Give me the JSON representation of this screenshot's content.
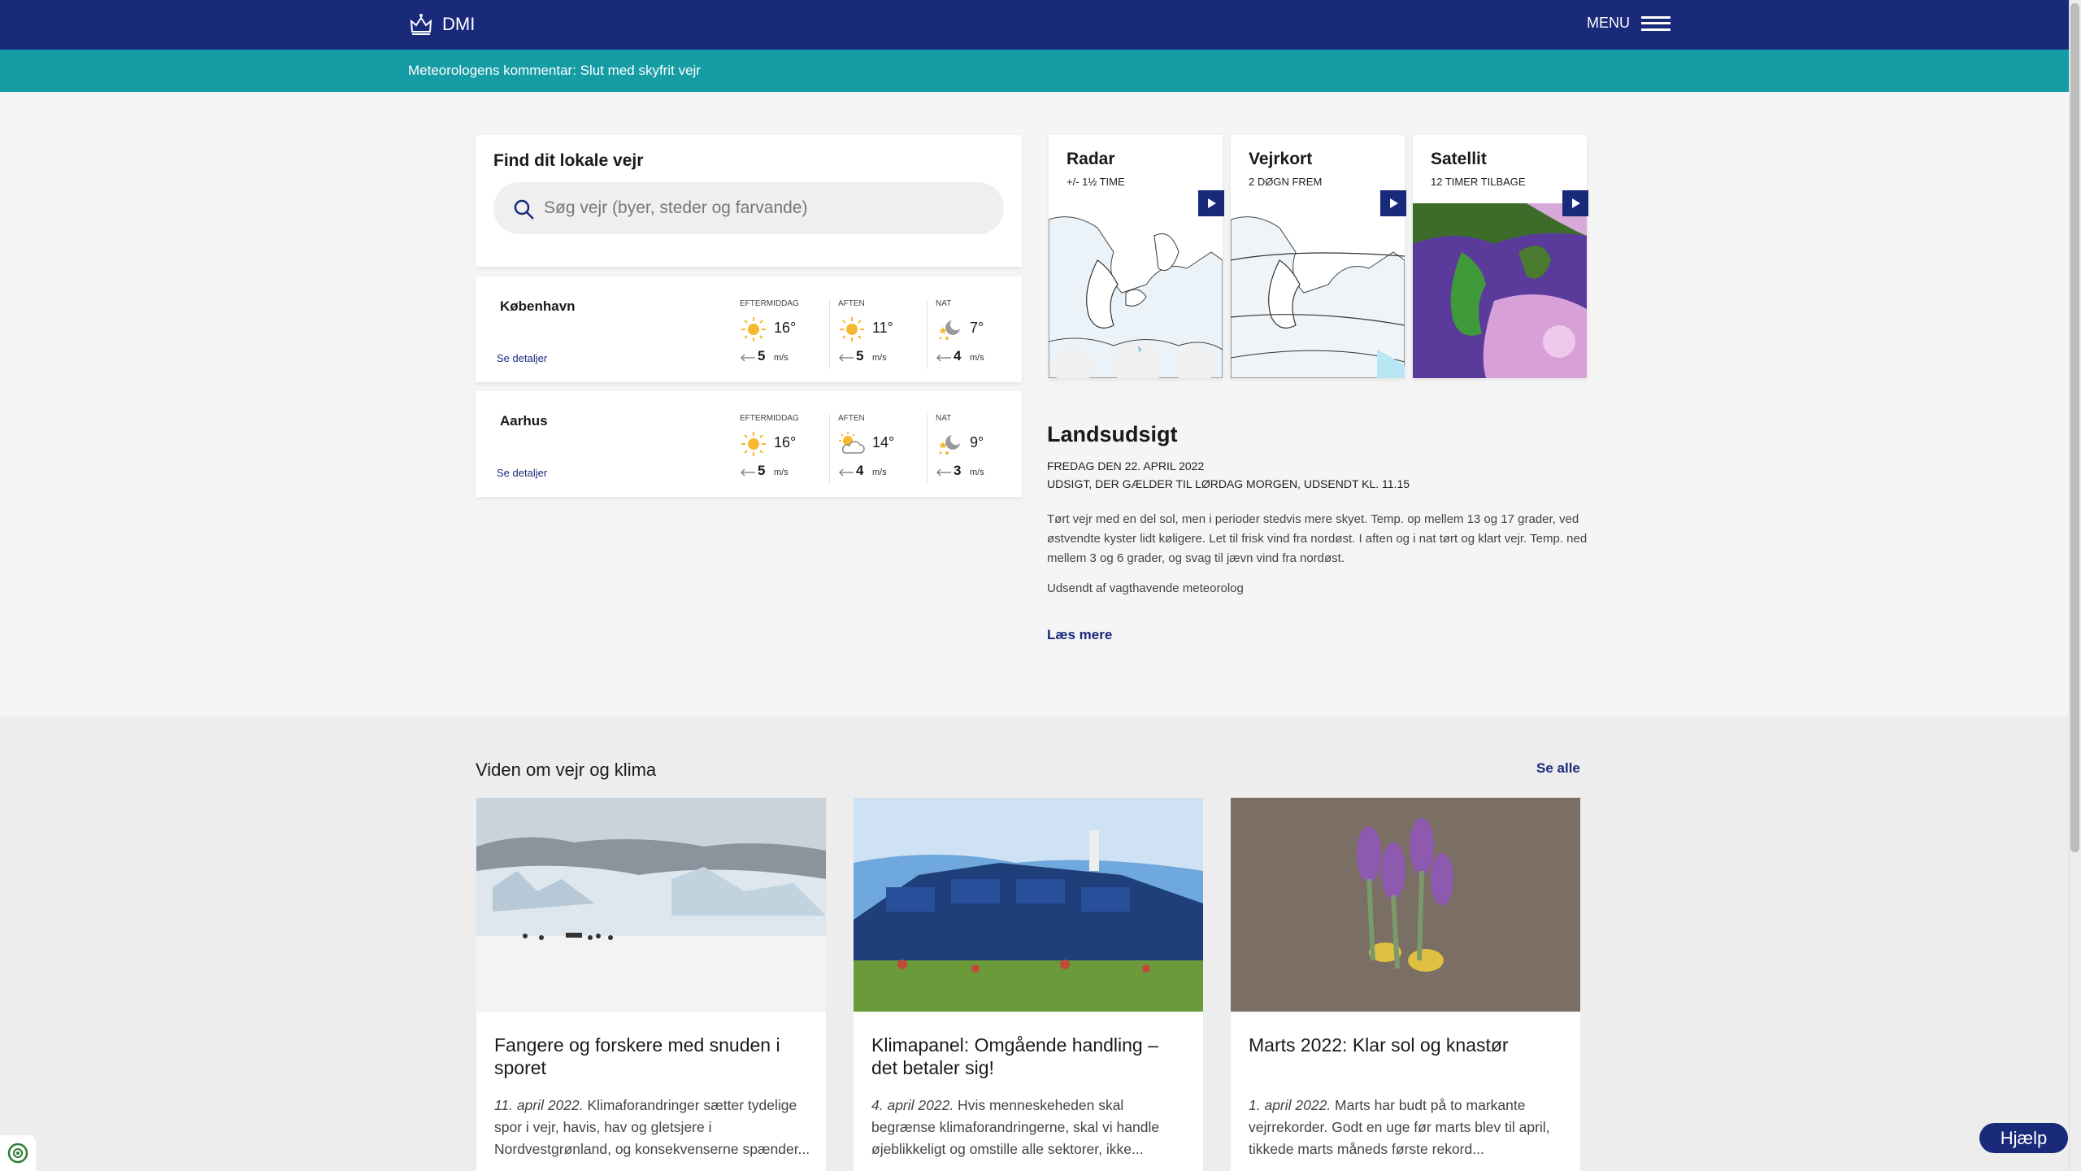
{
  "header": {
    "logo_text": "DMI",
    "menu_label": "MENU",
    "comment_link": "Meteorologens kommentar: Slut med skyfrit vejr"
  },
  "search": {
    "title": "Find dit lokale vejr",
    "placeholder": "Søg vejr (byer, steder og farvande)"
  },
  "cities": [
    {
      "name": "København",
      "details_link": "Se detaljer",
      "periods": [
        {
          "label": "EFTERMIDDAG",
          "icon": "sun-icon",
          "temp": "16°",
          "wind": "5",
          "unit": "m/s"
        },
        {
          "label": "AFTEN",
          "icon": "sun-icon",
          "temp": "11°",
          "wind": "5",
          "unit": "m/s"
        },
        {
          "label": "NAT",
          "icon": "moon-stars-icon",
          "temp": "7°",
          "wind": "4",
          "unit": "m/s"
        }
      ]
    },
    {
      "name": "Aarhus",
      "details_link": "Se detaljer",
      "periods": [
        {
          "label": "EFTERMIDDAG",
          "icon": "sun-icon",
          "temp": "16°",
          "wind": "5",
          "unit": "m/s"
        },
        {
          "label": "AFTEN",
          "icon": "partly-cloudy-icon",
          "temp": "14°",
          "wind": "4",
          "unit": "m/s"
        },
        {
          "label": "NAT",
          "icon": "moon-stars-icon",
          "temp": "9°",
          "wind": "3",
          "unit": "m/s"
        }
      ]
    }
  ],
  "maps": [
    {
      "title": "Radar",
      "subtitle": "+/- 1½ TIME"
    },
    {
      "title": "Vejrkort",
      "subtitle": "2 DØGN FREM"
    },
    {
      "title": "Satellit",
      "subtitle": "12 TIMER TILBAGE"
    }
  ],
  "landsudsigt": {
    "title": "Landsudsigt",
    "date": "FREDAG DEN 22. APRIL 2022",
    "subtitle": "UDSIGT, DER GÆLDER TIL LØRDAG MORGEN, UDSENDT KL. 11.15",
    "text": "Tørt vejr med en del sol, men i perioder stedvis mere skyet. Temp. op mellem 13 og 17 grader, ved østvendte kyster lidt køligere. Let til frisk vind fra nordøst. I aften og i nat tørt og klart vejr. Temp. ned mellem 3 og 6 grader, og svag til jævn vind fra nordøst.",
    "author": "Udsendt af vagthavende meteorolog",
    "more": "Læs mere"
  },
  "knowledge": {
    "title": "Viden om vejr og klima",
    "see_all": "Se alle",
    "articles": [
      {
        "title": "Fangere og forskere med snuden i sporet",
        "date": "11. april 2022.",
        "text": " Klimaforandringer sætter tydelige spor i vejr, havis, hav og gletsjere i Nordvestgrønland, og konsekvenserne spænder..."
      },
      {
        "title": "Klimapanel: Omgående handling – det betaler sig!",
        "date": "4. april 2022.",
        "text": " Hvis menneskeheden skal begrænse klimaforandringerne, skal vi handle øjeblikkeligt og omstille alle sektorer, ikke..."
      },
      {
        "title": "Marts 2022: Klar sol og knastør",
        "date": "1. april 2022.",
        "text": " Marts har budt på to markante vejrrekorder. Godt en uge før marts blev til april, tikkede marts måneds første rekord..."
      }
    ]
  },
  "help_label": "Hjælp",
  "colors": {
    "brand": "#1a2a7b",
    "accent": "#159ca4"
  }
}
